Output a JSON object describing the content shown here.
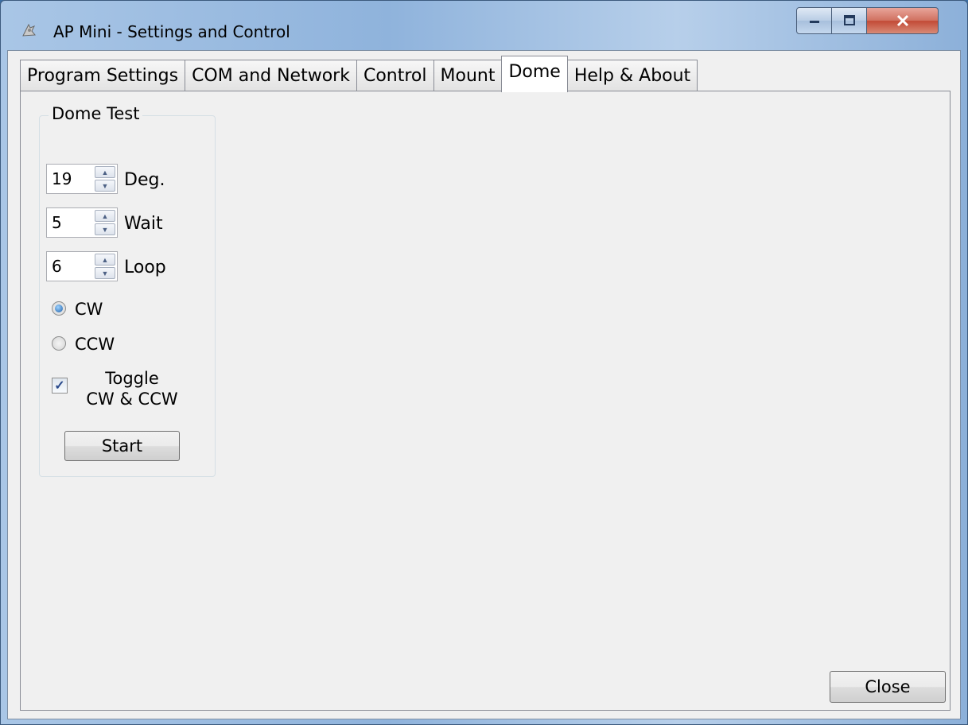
{
  "window": {
    "title": "AP Mini - Settings and Control"
  },
  "tabs": [
    {
      "label": "Program Settings"
    },
    {
      "label": "COM and Network"
    },
    {
      "label": "Control"
    },
    {
      "label": "Mount"
    },
    {
      "label": "Dome",
      "active": true
    },
    {
      "label": "Help & About"
    }
  ],
  "dome_test": {
    "title": "Dome Test",
    "degrees": {
      "value": "19",
      "label": "Deg."
    },
    "wait": {
      "value": "5",
      "label": "Wait"
    },
    "loop": {
      "value": "6",
      "label": "Loop"
    },
    "cw_label": "CW",
    "ccw_label": "CCW",
    "direction_selected": "CW",
    "toggle_label_line1": "Toggle",
    "toggle_label_line2": "CW & CCW",
    "toggle_checked": true,
    "start_label": "Start"
  },
  "footer": {
    "close_label": "Close"
  }
}
